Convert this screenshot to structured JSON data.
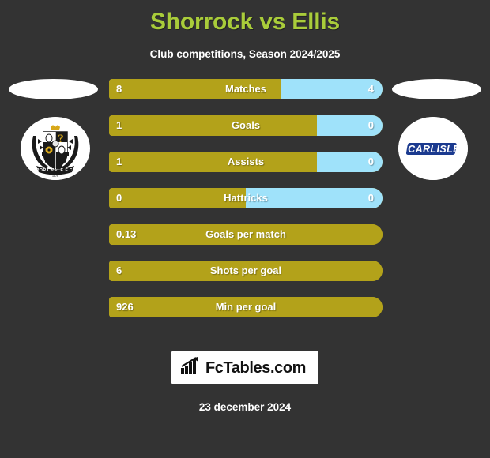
{
  "header": {
    "title": "Shorrock vs Ellis",
    "subtitle": "Club competitions, Season 2024/2025",
    "title_color": "#a9cc3a"
  },
  "teams": {
    "home": {
      "badge_icon": "port-vale-crest-icon",
      "badge_text": "PORT VALE F.C.",
      "badge_year": "1876"
    },
    "away": {
      "badge_icon": "carlisle-united-crest-icon",
      "badge_text": "CARLISLE"
    }
  },
  "colors": {
    "background": "#333333",
    "home_bar": "#b3a21a",
    "away_bar": "#9fe2fa",
    "accent": "#a9cc3a"
  },
  "chart_data": {
    "type": "bar",
    "title": "Shorrock vs Ellis",
    "subtitle": "Club competitions, Season 2024/2025",
    "orientation": "horizontal-diverging",
    "series": [
      {
        "name": "Shorrock",
        "color": "#b3a21a"
      },
      {
        "name": "Ellis",
        "color": "#9fe2fa"
      }
    ],
    "categories": [
      "Matches",
      "Goals",
      "Assists",
      "Hattricks",
      "Goals per match",
      "Shots per goal",
      "Min per goal"
    ],
    "rows": [
      {
        "label": "Matches",
        "home": "8",
        "away": "4",
        "home_pct": 63,
        "has_away": true
      },
      {
        "label": "Goals",
        "home": "1",
        "away": "0",
        "home_pct": 76,
        "has_away": true
      },
      {
        "label": "Assists",
        "home": "1",
        "away": "0",
        "home_pct": 76,
        "has_away": true
      },
      {
        "label": "Hattricks",
        "home": "0",
        "away": "0",
        "home_pct": 50,
        "has_away": true
      },
      {
        "label": "Goals per match",
        "home": "0.13",
        "away": "",
        "home_pct": 100,
        "has_away": false
      },
      {
        "label": "Shots per goal",
        "home": "6",
        "away": "",
        "home_pct": 100,
        "has_away": false
      },
      {
        "label": "Min per goal",
        "home": "926",
        "away": "",
        "home_pct": 100,
        "has_away": false
      }
    ]
  },
  "footer": {
    "brand": "FcTables.com",
    "brand_icon": "bar-chart-up-icon",
    "date": "23 december 2024"
  }
}
